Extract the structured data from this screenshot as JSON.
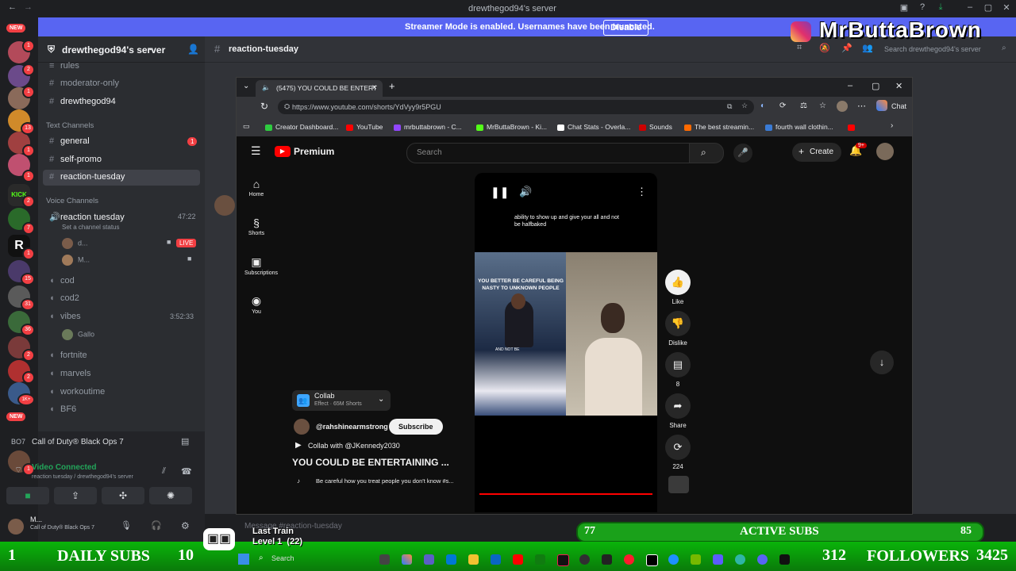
{
  "window": {
    "title": "drewthegod94's server"
  },
  "banner": {
    "message": "Streamer Mode is enabled. Usernames have been truncated.",
    "disable_label": "Disable"
  },
  "brand": {
    "name": "MrButtaBrown"
  },
  "rail": {
    "new_label": "NEW",
    "badges": [
      "1",
      "2",
      "1",
      "13",
      "1",
      "1",
      "2",
      "7",
      "1",
      "15",
      "31",
      "36",
      "2",
      "2",
      "1K+",
      "1"
    ]
  },
  "server": {
    "name": "drewthegod94's server",
    "channels_top": [
      "rules",
      "moderator-only",
      "drewthegod94"
    ],
    "text_category": "Text Channels",
    "text_channels": [
      {
        "name": "general",
        "badge": "1"
      },
      {
        "name": "self-promo"
      },
      {
        "name": "reaction-tuesday"
      }
    ],
    "voice_category": "Voice Channels",
    "voice_channels": [
      {
        "name": "reaction tuesday",
        "time": "47:22",
        "status": "Set a channel status"
      },
      {
        "name": "cod"
      },
      {
        "name": "cod2"
      },
      {
        "name": "vibes",
        "time": "3:52:33"
      },
      {
        "name": "fortnite"
      },
      {
        "name": "marvels"
      },
      {
        "name": "workoutime"
      },
      {
        "name": "BF6"
      }
    ],
    "voice_users": [
      {
        "name": "d...",
        "live": "LIVE"
      },
      {
        "name": "M..."
      }
    ],
    "vibes_user": "Gallo"
  },
  "activity": {
    "game": "Call of Duty® Black Ops 7"
  },
  "voice_status": {
    "title": "Video Connected",
    "subtitle": "reaction tuesday / drewthegod94's server"
  },
  "user_panel": {
    "name": "M...",
    "activity": "Call of Duty® Black Ops 7"
  },
  "chat": {
    "channel_title": "reaction-tuesday",
    "search_placeholder": "Search drewthegod94's server",
    "input_placeholder": "Message #reaction-tuesday"
  },
  "browser": {
    "tab_title": "(5475) YOU COULD BE ENTERT",
    "url": "https://www.youtube.com/shorts/YdVyy9r5PGU",
    "chat_label": "Chat",
    "bookmarks": [
      {
        "label": "Creator Dashboard...",
        "color": "#2ecc40"
      },
      {
        "label": "YouTube",
        "color": "#ff0000"
      },
      {
        "label": "mrbuttabrown - C...",
        "color": "#9146ff"
      },
      {
        "label": "MrButtaBrown - Ki...",
        "color": "#53fc18"
      },
      {
        "label": "Chat Stats - Overla...",
        "color": "#ffffff"
      },
      {
        "label": "Sounds",
        "color": "#cc0000"
      },
      {
        "label": "The best streamin...",
        "color": "#ff6a00"
      },
      {
        "label": "fourth wall clothin...",
        "color": "#3a7bd5"
      }
    ]
  },
  "youtube": {
    "logo": "Premium",
    "search_placeholder": "Search",
    "create_label": "Create",
    "notif_count": "9+",
    "nav": [
      "Home",
      "Shorts",
      "Subscriptions",
      "You"
    ],
    "caption_top": "ability to show up and give your all and not be halfbaked",
    "video_caption": "YOU BETTER BE CAREFUL BEING NASTY TO UNKNOWN PEOPLE",
    "video_sub": "AND NOT BE",
    "collab": {
      "title": "Collab",
      "meta": "Effect · 65M Shorts"
    },
    "channel_handle": "@rahshinearmstrong",
    "subscribe_label": "Subscribe",
    "collab_with": "Collab with @JKennedy2030",
    "short_title": "YOU COULD BE ENTERTAINING ...",
    "description": "Be careful how you treat people you don't know #s...",
    "actions": [
      {
        "label": "Like"
      },
      {
        "label": "Dislike"
      },
      {
        "label": "8"
      },
      {
        "label": "Share"
      },
      {
        "label": "224"
      }
    ]
  },
  "overlay": {
    "active_subs_label": "ACTIVE SUBS",
    "active_subs_left": "77",
    "active_subs_right": "85",
    "daily_subs_left": "1",
    "daily_subs_label": "DAILY SUBS",
    "daily_subs_right": "10",
    "followers_left": "312",
    "followers_label": "FOLLOWERS",
    "followers_right": "3425",
    "game_title": "Last Train",
    "game_level": "Level 1  (22)"
  },
  "taskbar": {
    "search_label": "Search"
  }
}
